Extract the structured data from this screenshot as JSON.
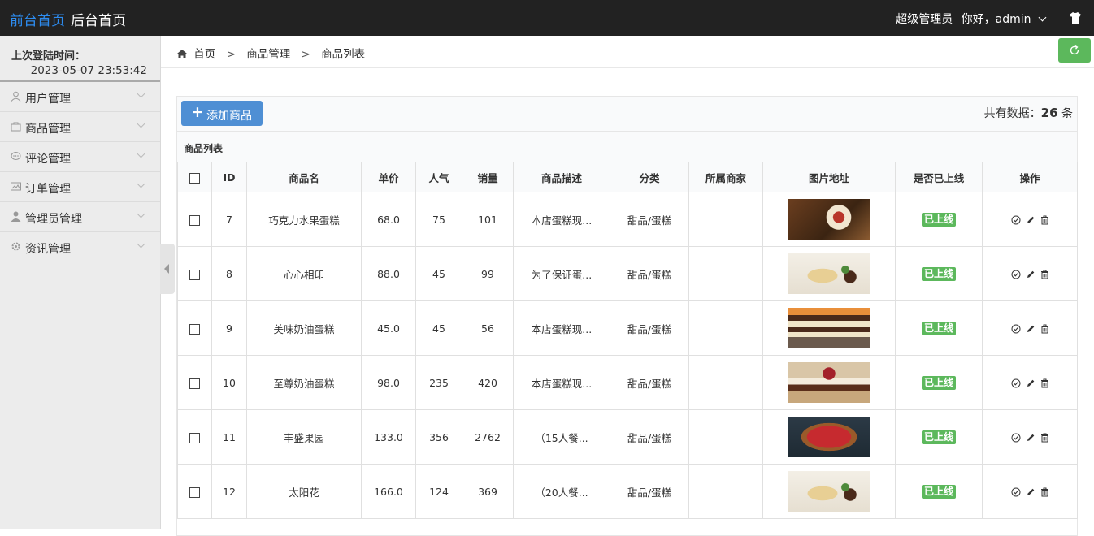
{
  "header": {
    "front_link": "前台首页",
    "back_link": "后台首页",
    "role": "超级管理员",
    "greeting": "你好，admin"
  },
  "sidebar": {
    "last_login_label": "上次登陆时间：",
    "last_login_value": "2023-05-07 23:53:42",
    "items": [
      {
        "label": "用户管理",
        "icon": "user-icon"
      },
      {
        "label": "商品管理",
        "icon": "shop-icon"
      },
      {
        "label": "评论管理",
        "icon": "comment-icon"
      },
      {
        "label": "订单管理",
        "icon": "order-icon"
      },
      {
        "label": "管理员管理",
        "icon": "admin-icon"
      },
      {
        "label": "资讯管理",
        "icon": "gear-icon"
      }
    ]
  },
  "breadcrumb": {
    "home": "首页",
    "sep": ">",
    "level1": "商品管理",
    "level2": "商品列表"
  },
  "toolbar": {
    "add_label": "添加商品",
    "total_prefix": "共有数据：",
    "total_count": "26",
    "total_suffix": "条"
  },
  "table": {
    "caption": "商品列表",
    "headers": [
      "ID",
      "商品名",
      "单价",
      "人气",
      "销量",
      "商品描述",
      "分类",
      "所属商家",
      "图片地址",
      "是否已上线",
      "操作"
    ],
    "rows": [
      {
        "id": "7",
        "name": "巧克力水果蛋糕",
        "price": "68.0",
        "popularity": "75",
        "sales": "101",
        "desc": "本店蛋糕现...",
        "category": "甜品/蛋糕",
        "merchant": "",
        "status": "已上线",
        "image": "chocolate-fruit-cake"
      },
      {
        "id": "8",
        "name": "心心相印",
        "price": "88.0",
        "popularity": "45",
        "sales": "99",
        "desc": "为了保证蛋...",
        "category": "甜品/蛋糕",
        "merchant": "",
        "status": "已上线",
        "image": "cream-cake-slice"
      },
      {
        "id": "9",
        "name": "美味奶油蛋糕",
        "price": "45.0",
        "popularity": "45",
        "sales": "56",
        "desc": "本店蛋糕现...",
        "category": "甜品/蛋糕",
        "merchant": "",
        "status": "已上线",
        "image": "layer-cake-slice"
      },
      {
        "id": "10",
        "name": "至尊奶油蛋糕",
        "price": "98.0",
        "popularity": "235",
        "sales": "420",
        "desc": "本店蛋糕现...",
        "category": "甜品/蛋糕",
        "merchant": "",
        "status": "已上线",
        "image": "berry-cake-slice"
      },
      {
        "id": "11",
        "name": "丰盛果园",
        "price": "133.0",
        "popularity": "356",
        "sales": "2762",
        "desc": "（15人餐...",
        "category": "甜品/蛋糕",
        "merchant": "",
        "status": "已上线",
        "image": "fruit-tart"
      },
      {
        "id": "12",
        "name": "太阳花",
        "price": "166.0",
        "popularity": "124",
        "sales": "369",
        "desc": "（20人餐...",
        "category": "甜品/蛋糕",
        "merchant": "",
        "status": "已上线",
        "image": "cream-cake-slice"
      }
    ]
  },
  "colors": {
    "accent": "#2d8cf0",
    "success": "#5cb85c",
    "button": "#4f8fd4",
    "topbar": "#222222"
  }
}
